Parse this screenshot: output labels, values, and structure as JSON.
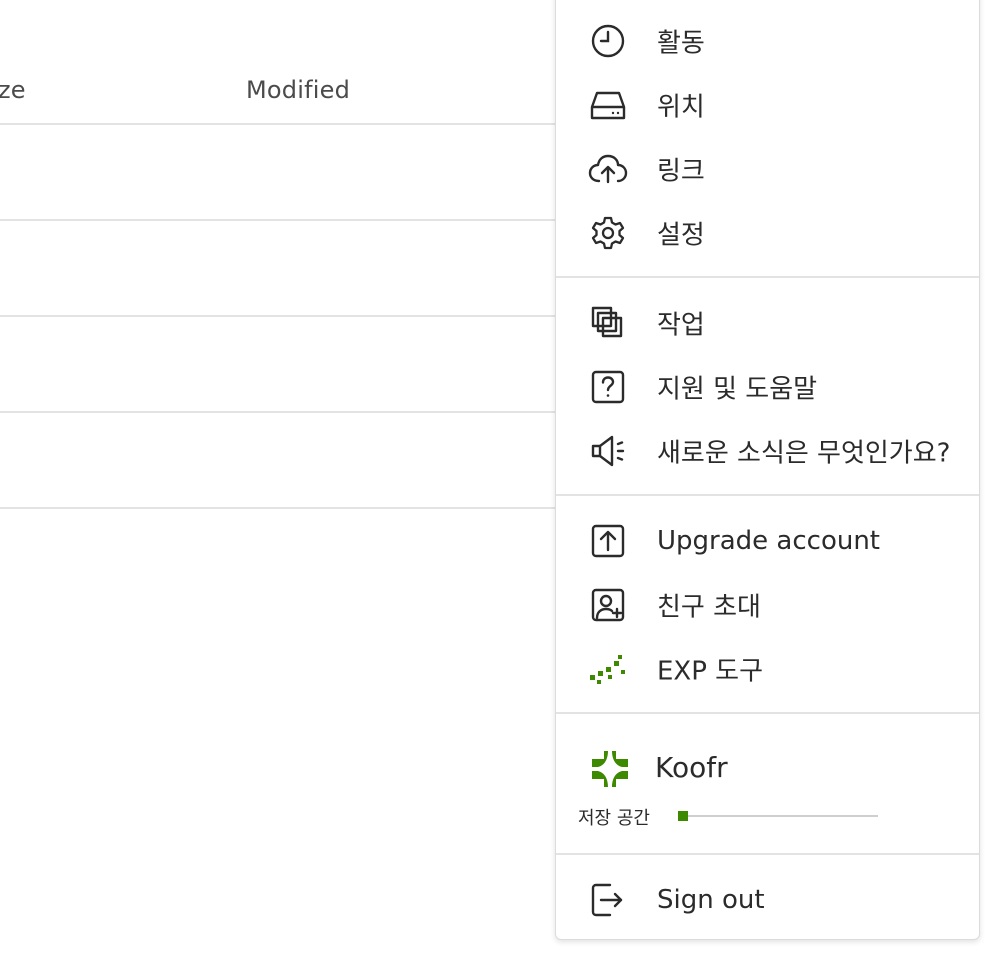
{
  "file_list": {
    "columns": {
      "size": "ze",
      "modified": "Modified"
    }
  },
  "menu": {
    "items": [
      {
        "label": "활동",
        "icon": "clock-icon"
      },
      {
        "label": "위치",
        "icon": "drive-icon"
      },
      {
        "label": "링크",
        "icon": "cloud-upload-icon"
      },
      {
        "label": "설정",
        "icon": "gear-icon"
      },
      {
        "label": "작업",
        "icon": "stacked-copies-icon"
      },
      {
        "label": "지원 및 도움말",
        "icon": "help-icon"
      },
      {
        "label": "새로운 소식은 무엇인가요?",
        "icon": "megaphone-icon"
      },
      {
        "label": "Upgrade account",
        "icon": "upgrade-icon"
      },
      {
        "label": "친구 초대",
        "icon": "invite-friend-icon"
      },
      {
        "label": "EXP 도구",
        "icon": "exp-tools-icon"
      }
    ],
    "brand": {
      "name": "Koofr",
      "icon": "koofr-logo-icon"
    },
    "storage": {
      "label": "저장 공간",
      "used_fraction": 0.03
    },
    "sign_out": {
      "label": "Sign out",
      "icon": "sign-out-icon"
    }
  },
  "colors": {
    "accent": "#3d8a00",
    "icon": "#2b2b2b",
    "divider": "#e3e3e3"
  }
}
